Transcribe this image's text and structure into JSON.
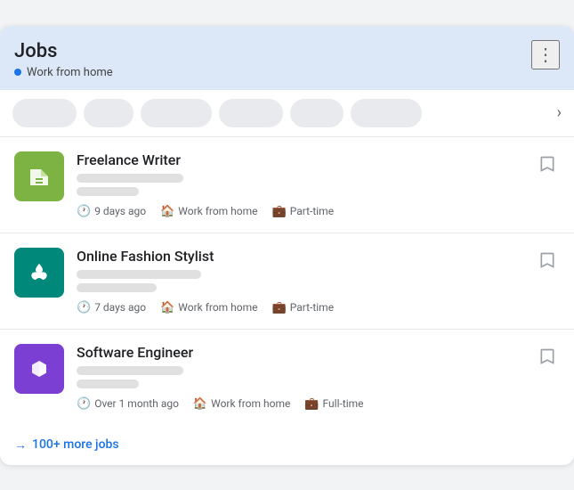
{
  "header": {
    "title": "Jobs",
    "subtitle": "Work from home",
    "kebab_label": "⋮"
  },
  "filters": [
    {
      "label": "",
      "width": 72
    },
    {
      "label": "",
      "width": 56
    },
    {
      "label": "",
      "width": 80
    },
    {
      "label": "",
      "width": 72
    },
    {
      "label": "",
      "width": 60
    },
    {
      "label": "",
      "width": 80
    }
  ],
  "jobs": [
    {
      "id": "freelance-writer",
      "title": "Freelance Writer",
      "logo_color": "green",
      "meta_time": "9 days ago",
      "meta_location": "Work from home",
      "meta_type": "Part-time"
    },
    {
      "id": "online-fashion-stylist",
      "title": "Online Fashion Stylist",
      "logo_color": "teal",
      "meta_time": "7 days ago",
      "meta_location": "Work from home",
      "meta_type": "Part-time"
    },
    {
      "id": "software-engineer",
      "title": "Software Engineer",
      "logo_color": "purple",
      "meta_time": "Over 1 month ago",
      "meta_location": "Work from home",
      "meta_type": "Full-time"
    }
  ],
  "more_jobs": {
    "label": "100+ more jobs",
    "arrow": "→"
  }
}
